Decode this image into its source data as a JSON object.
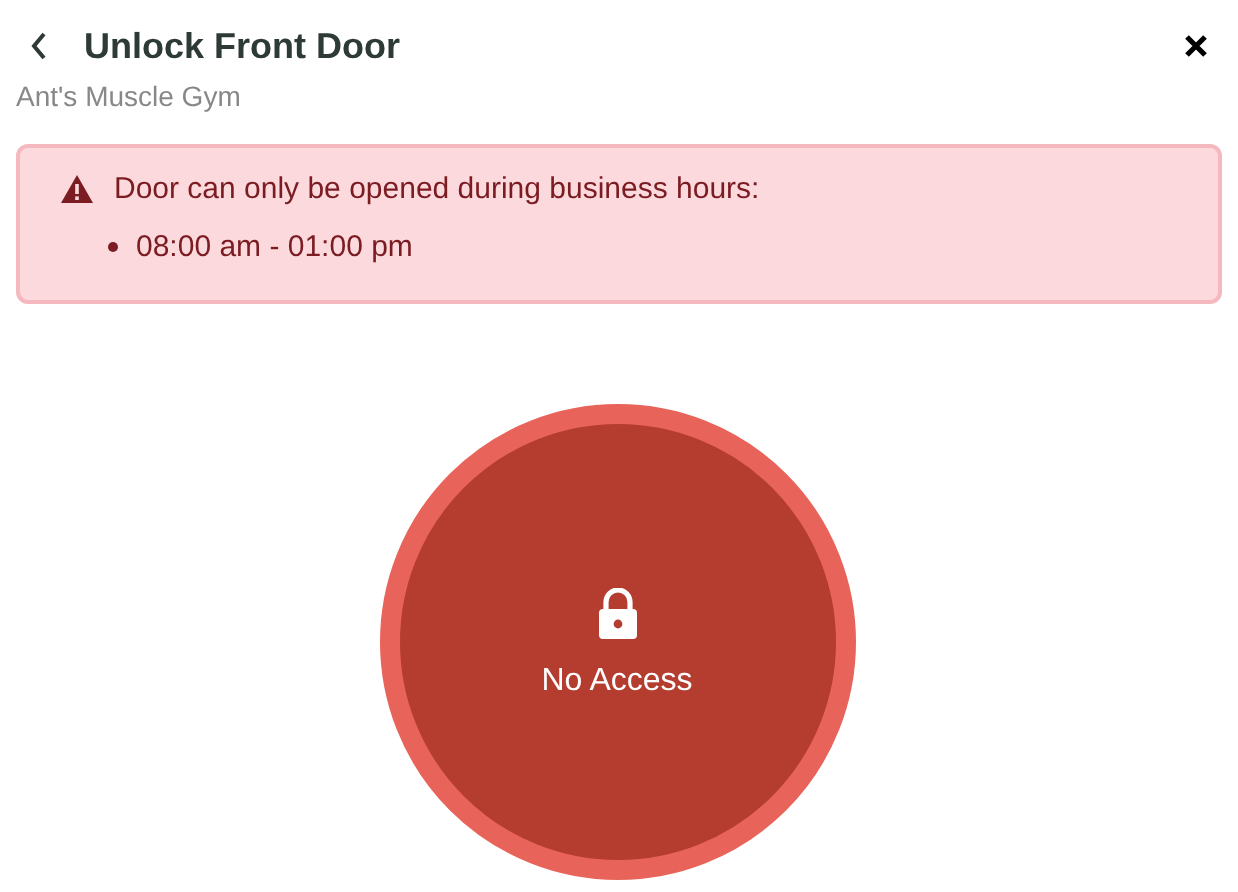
{
  "header": {
    "title": "Unlock Front Door",
    "subtitle": "Ant's Muscle Gym"
  },
  "alert": {
    "message": "Door can only be opened during business hours:",
    "items": [
      "08:00 am - 01:00 pm"
    ]
  },
  "access": {
    "label": "No Access",
    "locked": true
  }
}
